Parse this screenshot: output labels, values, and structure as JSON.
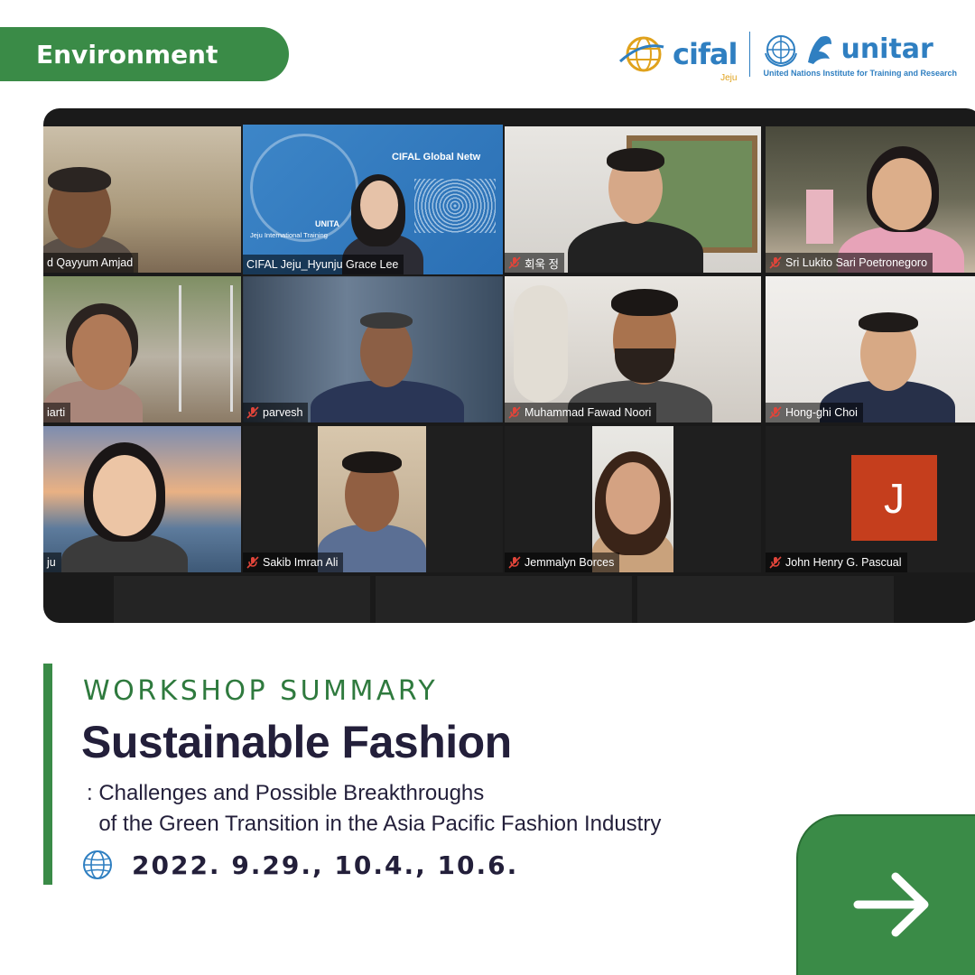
{
  "category": {
    "label": "Environment"
  },
  "logos": {
    "cifal_name": "cifal",
    "cifal_sub": "Jeju",
    "unitar_name": "unitar",
    "unitar_sub": "United Nations Institute for Training and Research"
  },
  "meeting": {
    "participants": [
      {
        "name": "d Qayyum Amjad",
        "muted": false
      },
      {
        "name": "CIFAL Jeju_Hyunju Grace Lee",
        "muted": false,
        "active": true
      },
      {
        "name": "회욱 정",
        "muted": true
      },
      {
        "name": "Sri Lukito Sari Poetronegoro",
        "muted": true
      },
      {
        "name": "iarti",
        "muted": false
      },
      {
        "name": "parvesh",
        "muted": true
      },
      {
        "name": "Muhammad Fawad Noori",
        "muted": true
      },
      {
        "name": "Hong-ghi Choi",
        "muted": true
      },
      {
        "name": "ju",
        "muted": false
      },
      {
        "name": "Sakib Imran Ali",
        "muted": true
      },
      {
        "name": "Jemmalyn Borces",
        "muted": true
      },
      {
        "name": "John Henry G. Pascual",
        "muted": true,
        "avatar_letter": "J"
      }
    ],
    "slide_text": {
      "network": "CIFAL Global Netw",
      "unitar": "UNITA",
      "jeju": "Jeju International Training"
    }
  },
  "summary": {
    "eyebrow": "WORKSHOP SUMMARY",
    "title": "Sustainable Fashion",
    "subtitle": ": Challenges and Possible Breakthroughs\n  of the Green Transition in the Asia Pacific Fashion Industry",
    "dates": "2022. 9.29., 10.4., 10.6."
  },
  "colors": {
    "brand_green": "#3a8b47",
    "title_navy": "#231f3a",
    "logo_blue": "#2f7fc1",
    "active_speaker": "#c8dc3c",
    "avatar_orange": "#c53e1d"
  },
  "icons": {
    "globe": "globe-icon",
    "next": "arrow-right-icon",
    "muted": "mic-muted-icon"
  }
}
